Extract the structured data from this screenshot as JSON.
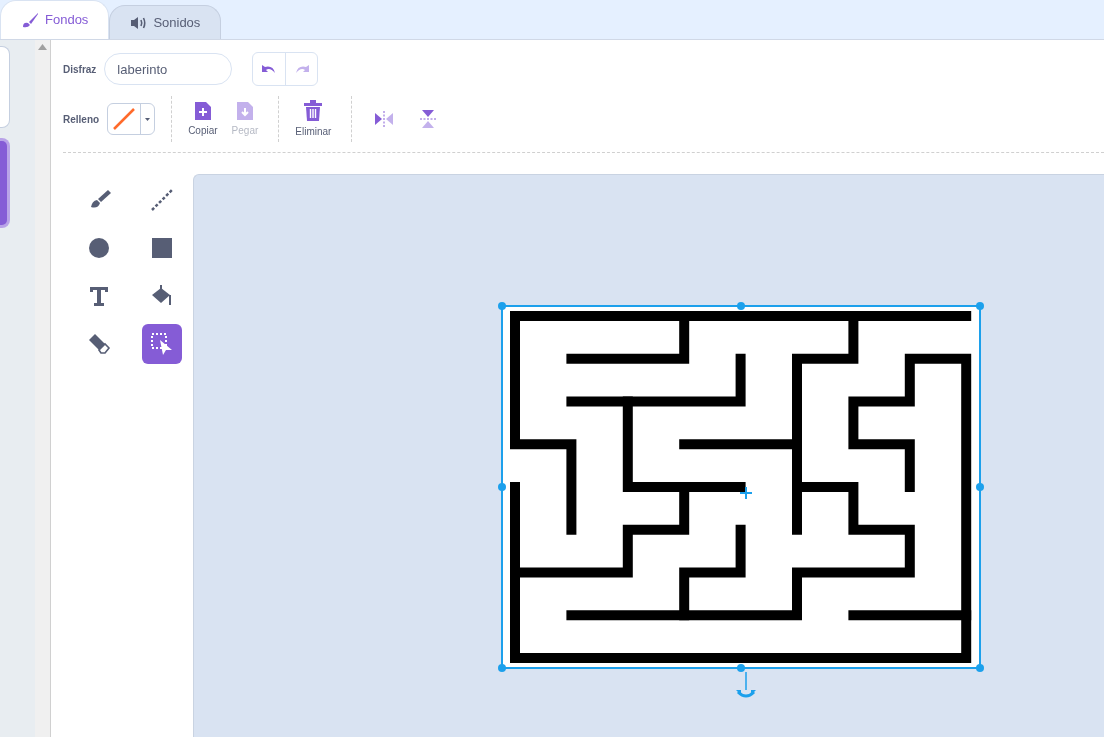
{
  "tabs": [
    {
      "label": "Fondos",
      "kind": "brush",
      "selected": true
    },
    {
      "label": "Sonidos",
      "kind": "speaker",
      "selected": false
    }
  ],
  "costume": {
    "label": "Disfraz",
    "value": "laberinto"
  },
  "history": [
    {
      "kind": "undo",
      "disabled": false
    },
    {
      "kind": "redo",
      "disabled": true
    }
  ],
  "fill": {
    "label": "Relleno",
    "color": "#ff6a2a"
  },
  "actions": [
    {
      "kind": "copy",
      "label": "Copiar",
      "disabled": false
    },
    {
      "kind": "paste",
      "label": "Pegar",
      "disabled": true
    },
    {
      "kind": "delete",
      "label": "Eliminar",
      "disabled": false
    }
  ],
  "tools": [
    {
      "kind": "brush",
      "selected": false
    },
    {
      "kind": "line",
      "selected": false
    },
    {
      "kind": "circle",
      "selected": false
    },
    {
      "kind": "rectangle",
      "selected": false
    },
    {
      "kind": "text",
      "selected": false
    },
    {
      "kind": "fill",
      "selected": false
    },
    {
      "kind": "eraser",
      "selected": false
    },
    {
      "kind": "select",
      "selected": true
    }
  ],
  "backdrops": [
    {
      "selected": false
    },
    {
      "selected": true
    }
  ]
}
